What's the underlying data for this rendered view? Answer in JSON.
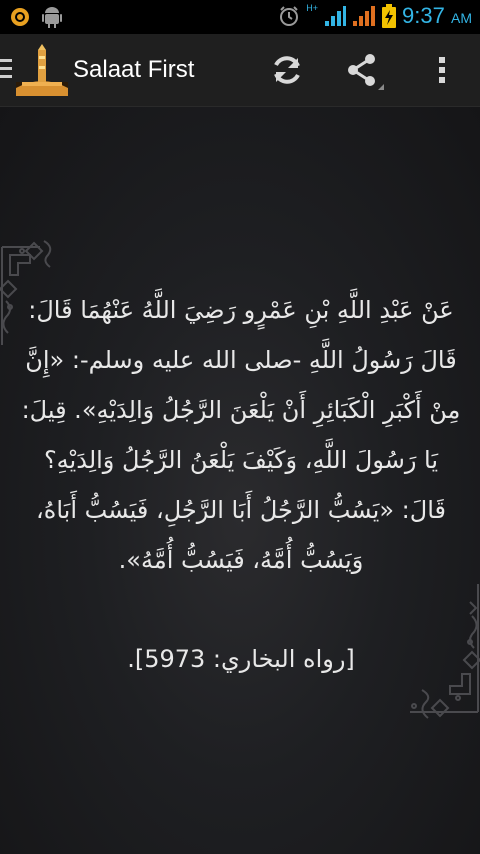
{
  "status_bar": {
    "network_label": "H+",
    "time": "9:37",
    "ampm": "AM",
    "icons": [
      "notification-icon",
      "android-debug-icon",
      "alarm-icon",
      "signal-icon",
      "signal-icon-2",
      "battery-charging-icon"
    ]
  },
  "action_bar": {
    "title": "Salaat First",
    "buttons": [
      "refresh-icon",
      "share-icon",
      "overflow-menu-icon"
    ]
  },
  "hadith": {
    "text": "عَنْ عَبْدِ اللَّهِ بْنِ عَمْرٍو رَضِيَ اللَّهُ عَنْهُمَا قَالَ: قَالَ رَسُولُ اللَّهِ -صلى الله عليه وسلم-: «إِنَّ مِنْ أَكْبَرِ الْكَبَائِرِ أَنْ يَلْعَنَ الرَّجُلُ وَالِدَيْهِ». قِيلَ: يَا رَسُولَ اللَّهِ، وَكَيْفَ يَلْعَنُ الرَّجُلُ وَالِدَيْهِ؟ قَالَ: «يَسُبُّ الرَّجُلُ أَبَا الرَّجُلِ، فَيَسُبُّ أَبَاهُ، وَيَسُبُّ أُمَّهُ، فَيَسُبُّ أُمَّهُ».",
    "source": "[رواه البخاري: 5973]."
  },
  "colors": {
    "status_accent": "#33b5e5",
    "action_bar": "#1f1f1f",
    "content_bg": "#1e1f22",
    "text": "#e8e8e8",
    "ornament": "#4a4a4e"
  }
}
